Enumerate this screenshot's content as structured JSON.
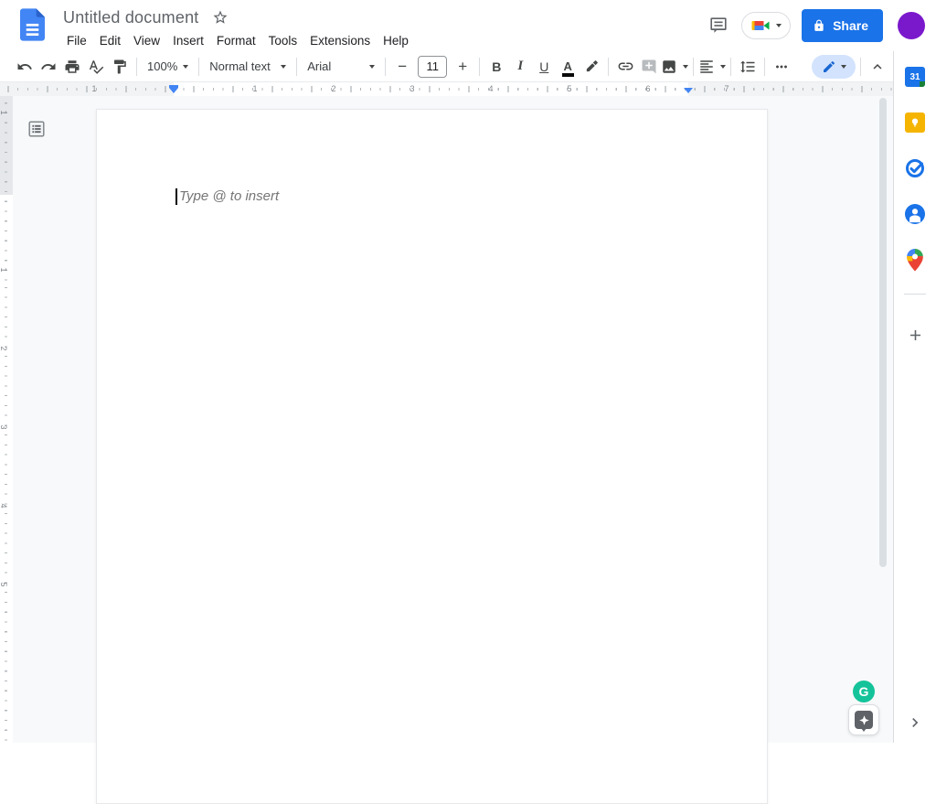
{
  "header": {
    "doc_title": "Untitled document",
    "menus": [
      "File",
      "Edit",
      "View",
      "Insert",
      "Format",
      "Tools",
      "Extensions",
      "Help"
    ],
    "share_label": "Share"
  },
  "toolbar": {
    "zoom_value": "100%",
    "paragraph_style": "Normal text",
    "font_family": "Arial",
    "font_size": "11",
    "bold_label": "B",
    "italic_label": "I",
    "underline_label": "U",
    "text_color_label": "A"
  },
  "ruler": {
    "h_left": [
      "1"
    ],
    "h_main": [
      "1",
      "2",
      "3",
      "4",
      "5",
      "6",
      "7"
    ],
    "v_top": [
      "1"
    ],
    "v_main": [
      "1",
      "2",
      "3",
      "4",
      "5"
    ]
  },
  "document": {
    "placeholder": "Type @ to insert"
  },
  "side_panel": {
    "calendar_label": "31",
    "grammarly_label": "G"
  },
  "colors": {
    "accent_blue": "#1a73e8",
    "docs_logo_blue": "#4285f4",
    "avatar_purple": "#7a18cc",
    "grammarly_green": "#15c39a",
    "editing_pill_bg": "#d3e3fd",
    "ruler_marker_blue": "#4285f4",
    "canvas_bg": "#f8f9fa"
  }
}
